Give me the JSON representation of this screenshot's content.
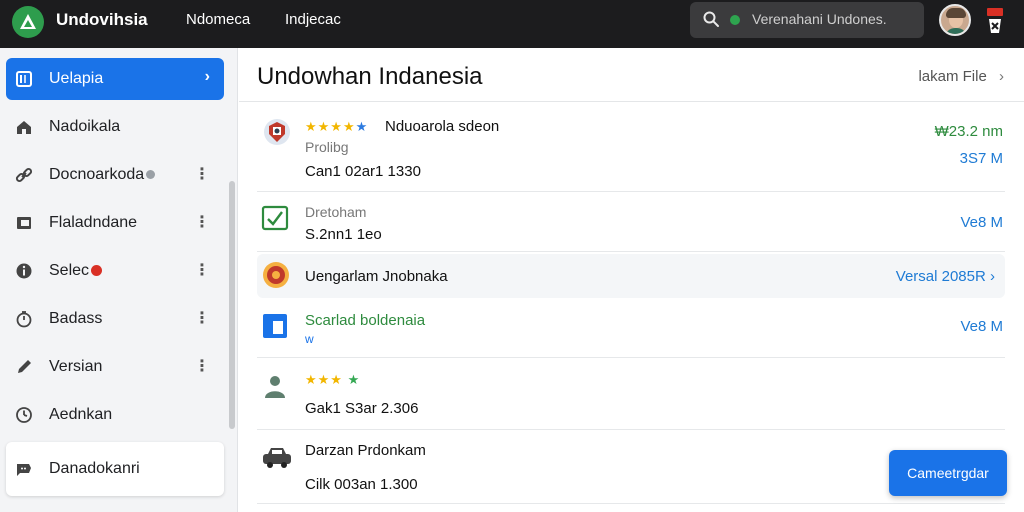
{
  "app": {
    "name": "Undovihsia",
    "nav": [
      "Ndomeca",
      "Indjecac"
    ],
    "search_text": "Verenahani Undones.",
    "colors": {
      "topbar": "#1c1c1e",
      "accent": "#1a73e8",
      "logo": "#2e9d4d"
    }
  },
  "sidebar": {
    "items": [
      {
        "label": "Uelapia",
        "icon": "panel-icon",
        "active": true,
        "trail": "›"
      },
      {
        "label": "Nadoikala",
        "icon": "home-icon"
      },
      {
        "label": "Docnoarkoda",
        "icon": "link-icon",
        "trail": "⋮"
      },
      {
        "label": "Flaladndane",
        "icon": "film-icon",
        "trail": "⋮"
      },
      {
        "label": "Selec",
        "icon": "info-icon",
        "trail": "⋮"
      },
      {
        "label": "Badass",
        "icon": "timer-icon",
        "trail": "⋮"
      },
      {
        "label": "Versian",
        "icon": "pencil-icon",
        "trail": "⋮"
      },
      {
        "label": "Aednkan",
        "icon": "clock-icon"
      },
      {
        "label": "Danadokanri",
        "icon": "chat-icon"
      }
    ]
  },
  "main": {
    "title": "Undowhan Indanesia",
    "header_action": "lakam File",
    "rows": [
      {
        "title": "Nduoarola sdeon",
        "sub": "Prolibg",
        "value": "Can1 02ar1 1330",
        "right_top": "₩23.2 nm",
        "right_bottom": "3S7 M",
        "icon": "emblem-icon"
      },
      {
        "sub": "Dretoham",
        "value": "S.2nn1 1eo",
        "right": "Ve8 M",
        "icon": "chart-check-icon"
      },
      {
        "title": "Uengarlam Jnobnaka",
        "right": "Versal 2085R",
        "icon": "seal-icon"
      },
      {
        "title": "Scarlad boldenaia",
        "sub": "w",
        "right": "Ve8 M",
        "icon": "window-icon"
      },
      {
        "value": "Gak1 S3ar 2.306",
        "icon": "user-icon"
      },
      {
        "title": "Darzan Prdonkam",
        "value": "Cilk 003an 1.300",
        "icon": "car-icon"
      }
    ],
    "fab_label": "Cameetrgdar"
  }
}
